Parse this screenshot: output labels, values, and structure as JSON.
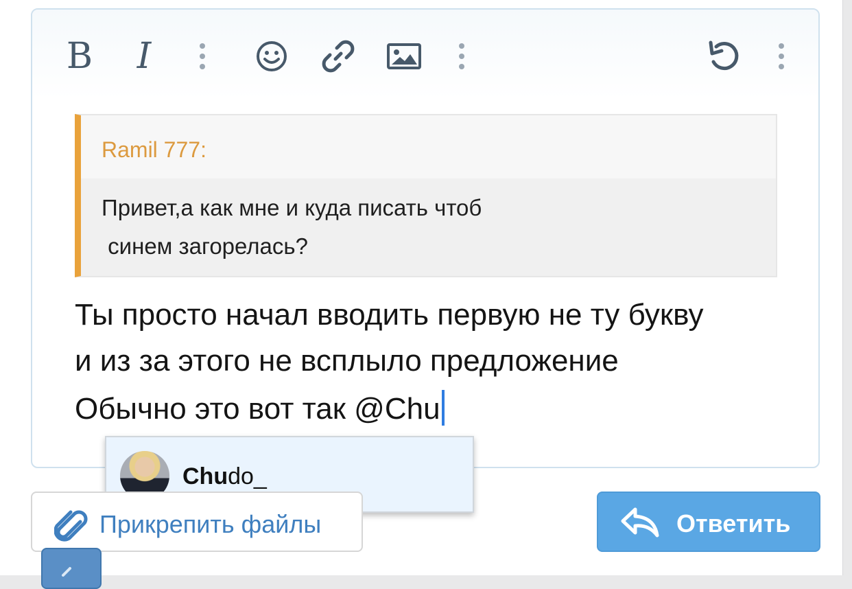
{
  "toolbar": {
    "bold_label": "B",
    "italic_label": "I",
    "icons": [
      "more-vertical-icon",
      "smile-icon",
      "link-icon",
      "image-icon",
      "more-vertical-icon",
      "undo-icon",
      "more-vertical-icon"
    ]
  },
  "quote": {
    "author": "Ramil 777:",
    "lines": [
      "Привет,а как мне и куда писать чтоб",
      " синем загорелась?"
    ]
  },
  "message": {
    "lines": [
      "Ты просто начал вводить первую не ту букву",
      "и из за этого не всплыло предложение",
      "Обычно это вот так @Chu"
    ]
  },
  "mention_popup": {
    "match": "Chu",
    "rest": "do_"
  },
  "buttons": {
    "attach_label": "Прикрепить файлы",
    "reply_label": "Ответить"
  },
  "colors": {
    "accent": "#5aa7e4",
    "quote_border": "#e9a23b",
    "quote_author": "#dc9a3f",
    "link": "#3f7fbf"
  }
}
